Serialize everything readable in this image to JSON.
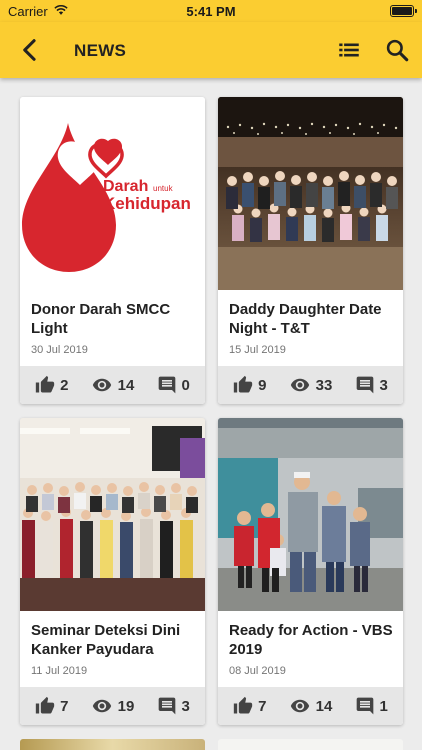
{
  "status_bar": {
    "carrier": "Carrier",
    "time": "5:41 PM"
  },
  "header": {
    "title": "NEWS"
  },
  "logo_text": {
    "line1": "Darah",
    "small": "untuk",
    "line2": "Kehidupan"
  },
  "colors": {
    "accent": "#fbcd31",
    "logo_red": "#d7262e"
  },
  "news": [
    {
      "title": "Donor Darah SMCC Light",
      "date": "30 Jul 2019",
      "likes": "2",
      "views": "14",
      "comments": "0"
    },
    {
      "title": "Daddy Daughter Date Night - T&T",
      "date": "15 Jul 2019",
      "likes": "9",
      "views": "33",
      "comments": "3"
    },
    {
      "title": "Seminar Deteksi Dini Kanker Payudara",
      "date": "11 Jul 2019",
      "likes": "7",
      "views": "19",
      "comments": "3"
    },
    {
      "title": "Ready for Action - VBS 2019",
      "date": "08 Jul 2019",
      "likes": "7",
      "views": "14",
      "comments": "1"
    }
  ]
}
